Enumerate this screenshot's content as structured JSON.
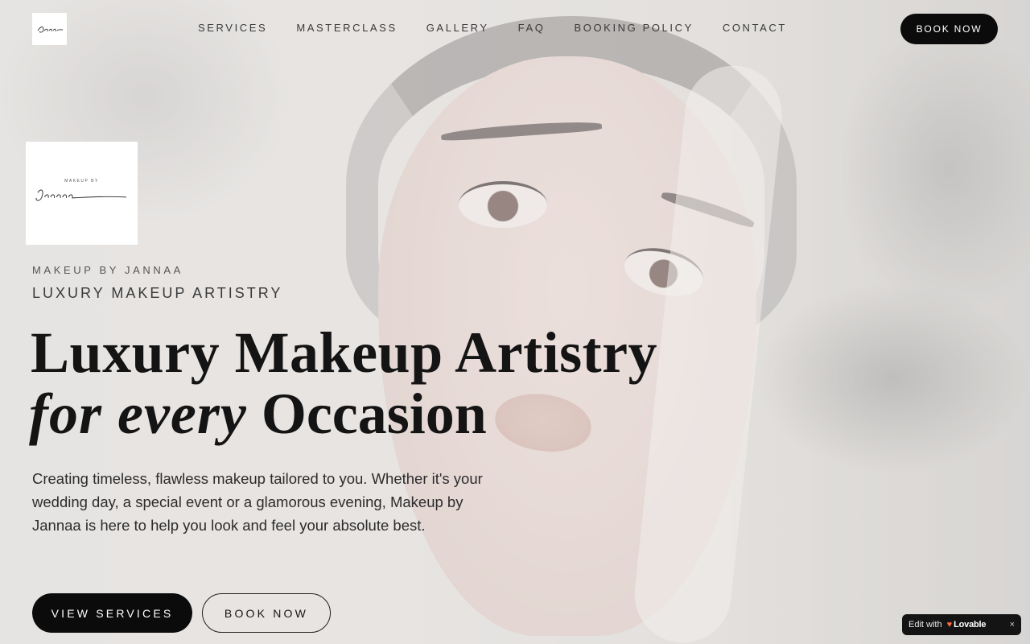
{
  "logo": {
    "small_alt": "Makeup by Jannaa logo",
    "large_tagline": "MAKEUP BY",
    "large_script": "Jannaa"
  },
  "nav": {
    "items": [
      {
        "label": "SERVICES"
      },
      {
        "label": "MASTERCLASS"
      },
      {
        "label": "GALLERY"
      },
      {
        "label": "FAQ"
      },
      {
        "label": "BOOKING POLICY"
      },
      {
        "label": "CONTACT"
      }
    ],
    "cta_label": "BOOK NOW"
  },
  "hero": {
    "eyebrow": "MAKEUP BY JANNAA",
    "subhead": "LUXURY MAKEUP ARTISTRY",
    "headline_line1": "Luxury Makeup Artistry",
    "headline_script": "for every",
    "headline_rest": "Occasion",
    "description": "Creating timeless, flawless makeup tailored to you. Whether it's your wedding day, a special event or a glamorous evening, Makeup by Jannaa is here to help you look and feel your absolute best.",
    "primary_cta": "VIEW SERVICES",
    "secondary_cta": "BOOK NOW"
  },
  "badge": {
    "edit_text": "Edit with",
    "brand": "Lovable",
    "close_glyph": "×"
  },
  "colors": {
    "primary_button": "#0b0b0c",
    "text": "#141414",
    "badge_accent": "#ff6a3d"
  }
}
